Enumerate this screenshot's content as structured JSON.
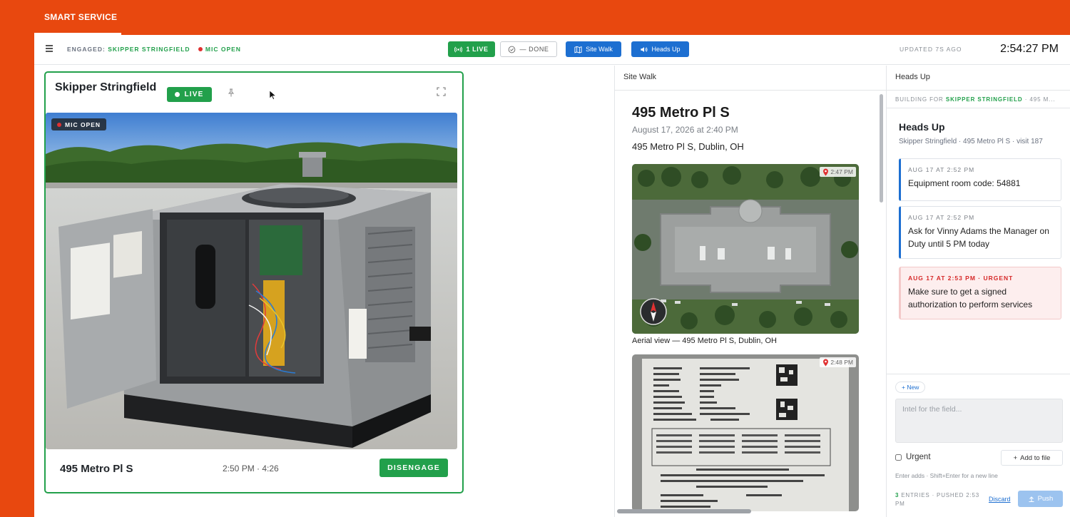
{
  "brand": "SMART SERVICE",
  "topbar": {
    "engaged_label": "ENGAGED:",
    "engaged_name": "SKIPPER STRINGFIELD",
    "mic_status": "MIC OPEN",
    "live_label": "1 LIVE",
    "done_label": "— DONE",
    "site_walk_label": "Site Walk",
    "heads_up_label": "Heads Up",
    "updated": "UPDATED 7S AGO",
    "clock": "2:54:27 PM"
  },
  "live_card": {
    "name": "Skipper Stringfield",
    "live_badge": "LIVE",
    "mic_badge": "MIC OPEN",
    "address": "495 Metro Pl S",
    "time": "2:50 PM · 4:26",
    "disengage_label": "DISENGAGE"
  },
  "site_walk": {
    "header": "Site Walk",
    "title": "495 Metro Pl S",
    "date": "August 17, 2026 at 2:40 PM",
    "address": "495 Metro Pl S, Dublin, OH",
    "photos": [
      {
        "time": "2:47 PM",
        "caption": "Aerial view — 495 Metro Pl S, Dublin, OH"
      },
      {
        "time": "2:48 PM"
      }
    ]
  },
  "heads_up": {
    "header": "Heads Up",
    "building_prefix": "BUILDING FOR",
    "building_name": "SKIPPER STRINGFIELD",
    "building_suffix": "· 495 M...",
    "title": "Heads Up",
    "subtitle": "Skipper Stringfield · 495 Metro Pl S · visit 187",
    "notes": [
      {
        "ts": "AUG 17 AT 2:52 PM",
        "text": "Equipment room code: 54881"
      },
      {
        "ts": "AUG 17 AT 2:52 PM",
        "text": "Ask for Vinny Adams the Manager on Duty until 5 PM today"
      },
      {
        "ts": "AUG 17 AT 2:53 PM · URGENT",
        "text": "Make sure to get a signed authorization to perform services"
      }
    ],
    "new_label": "+ New",
    "input_placeholder": "Intel for the field...",
    "urgent_label": "Urgent",
    "add_file_label": "Add to file",
    "hint": "Enter adds · Shift+Enter for a new line",
    "entries_count": "3",
    "entries_text": "ENTRIES · PUSHED 2:53 PM",
    "discard_label": "Discard",
    "push_label": "Push"
  },
  "colors": {
    "brand_orange": "#e8480f",
    "live_green": "#22a04b",
    "action_blue": "#1d6fd1",
    "urgent_red": "#d62828"
  },
  "icons": [
    "menu-icon",
    "broadcast-icon",
    "check-circle-icon",
    "map-icon",
    "speaker-icon",
    "pin-icon",
    "cursor-icon",
    "expand-icon",
    "location-pin-icon",
    "plus-icon",
    "upload-icon"
  ]
}
